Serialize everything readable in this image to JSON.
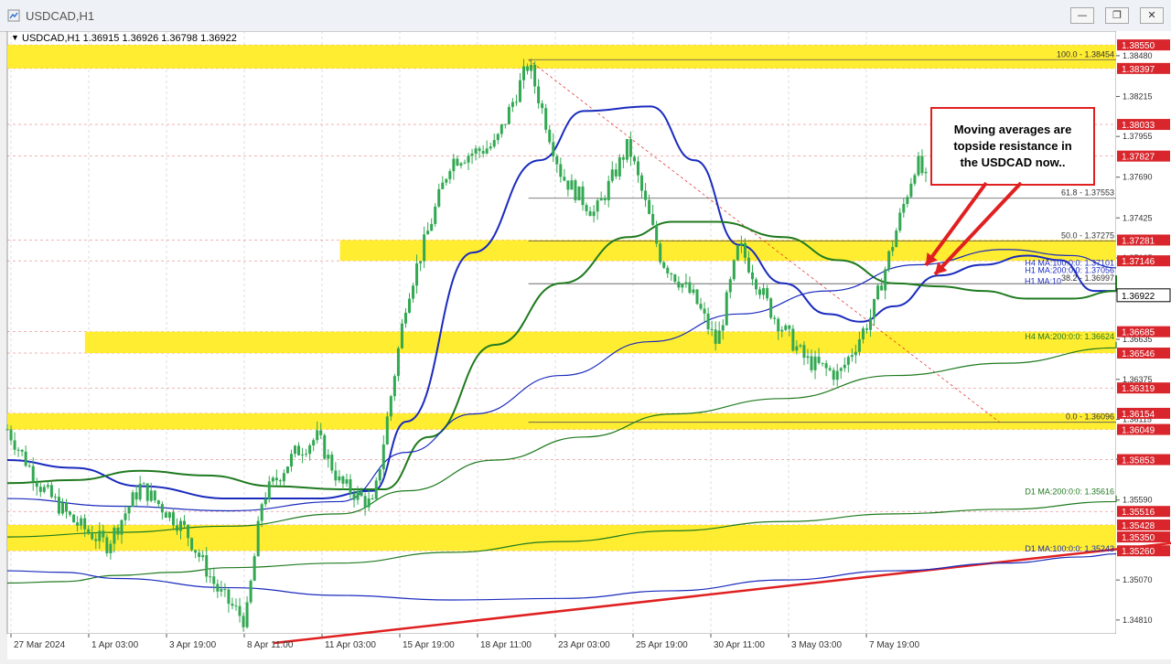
{
  "window": {
    "title": "USDCAD,H1",
    "icons": {
      "app": "chart-window-icon",
      "minimize": "minimize-icon",
      "maximize": "maximize-icon",
      "close": "close-icon"
    }
  },
  "colors": {
    "zone": "#ffec1f",
    "candle": "#32a852",
    "ma_blue": "#1a2bbd",
    "ma_green": "#1f7a1f",
    "trend": "#e02020",
    "callout_border": "#e02020",
    "price_box": "#d9262c"
  },
  "chart_data": {
    "type": "candlestick",
    "symbol_header": "USDCAD,H1  1.36915 1.36926 1.36798 1.36922",
    "ylim": [
      1.3472,
      1.3864
    ],
    "y_ticks": [
      "1.38480",
      "1.38215",
      "1.37955",
      "1.37690",
      "1.37425",
      "1.37165",
      "1.36635",
      "1.36375",
      "1.36115",
      "1.35855",
      "1.35590",
      "1.35070",
      "1.34810"
    ],
    "x_ticks": [
      "27 Mar 2024",
      "1 Apr 03:00",
      "3 Apr 19:00",
      "8 Apr 11:00",
      "11 Apr 03:00",
      "15 Apr 19:00",
      "18 Apr 11:00",
      "23 Apr 03:00",
      "25 Apr 19:00",
      "30 Apr 11:00",
      "3 May 03:00",
      "7 May 19:00"
    ],
    "zones": [
      {
        "low": 1.38397,
        "high": 1.3855,
        "start": 0.0
      },
      {
        "low": 1.37146,
        "high": 1.37281,
        "start": 0.3
      },
      {
        "low": 1.36546,
        "high": 1.36685,
        "start": 0.07
      },
      {
        "low": 1.36049,
        "high": 1.36154,
        "start": 0.0
      },
      {
        "low": 1.3526,
        "high": 1.35428,
        "start": 0.0
      }
    ],
    "price_labels": [
      "1.38550",
      "1.38397",
      "1.38033",
      "1.37827",
      "1.37281",
      "1.37146",
      "1.36685",
      "1.36546",
      "1.36319",
      "1.36154",
      "1.36049",
      "1.35853",
      "1.35516",
      "1.35428",
      "1.35350",
      "1.35260"
    ],
    "current_price": "1.36922",
    "fib_levels": [
      {
        "label": "100.0 - 1.38454",
        "value": 1.38454
      },
      {
        "label": "61.8 - 1.37553",
        "value": 1.37553
      },
      {
        "label": "50.0 - 1.37275",
        "value": 1.37275
      },
      {
        "label": "38.2 - 1.36997",
        "value": 1.36997
      },
      {
        "label": "0.0 - 1.36096",
        "value": 1.36096
      }
    ],
    "ma_labels": [
      {
        "label": "H4 MA:100:0:0: 1.37101",
        "value": 1.37101
      },
      {
        "label": "H1 MA:200:0:0: 1.37056",
        "value": 1.37056
      },
      {
        "label": "H1 MA:10",
        "value": 1.3703
      },
      {
        "label": "H4 MA:200:0:0: 1.36624",
        "value": 1.36624
      },
      {
        "label": "D1 MA:200:0:0: 1.35616",
        "value": 1.35616
      },
      {
        "label": "D1 MA:100:0:0: 1.35243",
        "value": 1.35243
      }
    ],
    "annotation": [
      "Moving averages are",
      "topside resistance in",
      "the USDCAD now.."
    ],
    "keypoints": [
      [
        0.0,
        1.3605
      ],
      [
        0.03,
        1.3568
      ],
      [
        0.06,
        1.3545
      ],
      [
        0.09,
        1.353
      ],
      [
        0.12,
        1.3568
      ],
      [
        0.16,
        1.354
      ],
      [
        0.19,
        1.35
      ],
      [
        0.215,
        1.348
      ],
      [
        0.23,
        1.356
      ],
      [
        0.26,
        1.359
      ],
      [
        0.28,
        1.36
      ],
      [
        0.3,
        1.357
      ],
      [
        0.33,
        1.3555
      ],
      [
        0.36,
        1.369
      ],
      [
        0.4,
        1.378
      ],
      [
        0.44,
        1.379
      ],
      [
        0.47,
        1.3843
      ],
      [
        0.5,
        1.377
      ],
      [
        0.53,
        1.3745
      ],
      [
        0.56,
        1.379
      ],
      [
        0.59,
        1.3715
      ],
      [
        0.62,
        1.369
      ],
      [
        0.64,
        1.366
      ],
      [
        0.66,
        1.3725
      ],
      [
        0.69,
        1.368
      ],
      [
        0.72,
        1.365
      ],
      [
        0.75,
        1.364
      ],
      [
        0.78,
        1.368
      ],
      [
        0.8,
        1.373
      ],
      [
        0.82,
        1.378
      ],
      [
        0.845,
        1.374
      ],
      [
        0.865,
        1.37
      ],
      [
        0.88,
        1.366
      ],
      [
        0.895,
        1.362
      ],
      [
        0.905,
        1.367
      ],
      [
        0.93,
        1.369
      ],
      [
        0.95,
        1.366
      ],
      [
        0.965,
        1.37
      ],
      [
        0.975,
        1.374
      ],
      [
        0.985,
        1.375
      ],
      [
        1.0,
        1.372
      ],
      [
        1.015,
        1.373
      ],
      [
        1.03,
        1.3715
      ],
      [
        1.05,
        1.3692
      ]
    ],
    "ma_series": [
      {
        "name": "H1 MA:100",
        "color": "#1a2bbd",
        "width": 2,
        "points": [
          [
            0.0,
            1.3585
          ],
          [
            0.06,
            1.358
          ],
          [
            0.12,
            1.3568
          ],
          [
            0.2,
            1.356
          ],
          [
            0.28,
            1.356
          ],
          [
            0.33,
            1.3565
          ],
          [
            0.36,
            1.361
          ],
          [
            0.42,
            1.372
          ],
          [
            0.48,
            1.378
          ],
          [
            0.52,
            1.3812
          ],
          [
            0.58,
            1.3815
          ],
          [
            0.62,
            1.378
          ],
          [
            0.66,
            1.3725
          ],
          [
            0.7,
            1.37
          ],
          [
            0.74,
            1.368
          ],
          [
            0.77,
            1.3675
          ],
          [
            0.8,
            1.3685
          ],
          [
            0.84,
            1.3705
          ],
          [
            0.88,
            1.3712
          ],
          [
            0.92,
            1.3718
          ],
          [
            0.95,
            1.3715
          ],
          [
            0.98,
            1.3695
          ],
          [
            1.01,
            1.3695
          ],
          [
            1.04,
            1.3705
          ]
        ]
      },
      {
        "name": "H1 MA:200",
        "color": "#1f7a1f",
        "width": 2,
        "points": [
          [
            0.0,
            1.357
          ],
          [
            0.06,
            1.3572
          ],
          [
            0.12,
            1.3578
          ],
          [
            0.18,
            1.3575
          ],
          [
            0.24,
            1.3568
          ],
          [
            0.3,
            1.3566
          ],
          [
            0.34,
            1.3566
          ],
          [
            0.38,
            1.36
          ],
          [
            0.44,
            1.366
          ],
          [
            0.5,
            1.37
          ],
          [
            0.56,
            1.373
          ],
          [
            0.6,
            1.374
          ],
          [
            0.64,
            1.374
          ],
          [
            0.7,
            1.373
          ],
          [
            0.75,
            1.3715
          ],
          [
            0.8,
            1.37
          ],
          [
            0.84,
            1.3698
          ],
          [
            0.88,
            1.3695
          ],
          [
            0.92,
            1.369
          ],
          [
            0.96,
            1.369
          ],
          [
            1.0,
            1.3695
          ],
          [
            1.04,
            1.3705
          ]
        ]
      },
      {
        "name": "H4 MA:100",
        "color": "#1a2bbd",
        "width": 1.2,
        "points": [
          [
            0.0,
            1.356
          ],
          [
            0.1,
            1.3555
          ],
          [
            0.2,
            1.3552
          ],
          [
            0.3,
            1.3558
          ],
          [
            0.36,
            1.359
          ],
          [
            0.42,
            1.3615
          ],
          [
            0.5,
            1.364
          ],
          [
            0.58,
            1.3662
          ],
          [
            0.66,
            1.368
          ],
          [
            0.74,
            1.3695
          ],
          [
            0.82,
            1.3712
          ],
          [
            0.9,
            1.3722
          ],
          [
            0.96,
            1.3718
          ],
          [
            1.04,
            1.371
          ],
          [
            1.1,
            1.371
          ]
        ]
      },
      {
        "name": "H4 MA:200",
        "color": "#1f7a1f",
        "width": 1.2,
        "points": [
          [
            0.0,
            1.3535
          ],
          [
            0.1,
            1.3538
          ],
          [
            0.2,
            1.3542
          ],
          [
            0.3,
            1.355
          ],
          [
            0.36,
            1.3565
          ],
          [
            0.44,
            1.3585
          ],
          [
            0.52,
            1.36
          ],
          [
            0.6,
            1.3615
          ],
          [
            0.7,
            1.3625
          ],
          [
            0.8,
            1.364
          ],
          [
            0.9,
            1.3648
          ],
          [
            1.0,
            1.3658
          ],
          [
            1.04,
            1.3662
          ],
          [
            1.1,
            1.3662
          ]
        ]
      },
      {
        "name": "D1 MA:200",
        "color": "#1f7a1f",
        "width": 1.2,
        "points": [
          [
            0.0,
            1.3505
          ],
          [
            0.05,
            1.3506
          ],
          [
            0.1,
            1.351
          ],
          [
            0.15,
            1.3512
          ],
          [
            0.2,
            1.3515
          ],
          [
            0.3,
            1.3518
          ],
          [
            0.4,
            1.3525
          ],
          [
            0.5,
            1.3532
          ],
          [
            0.6,
            1.3539
          ],
          [
            0.7,
            1.3545
          ],
          [
            0.8,
            1.355
          ],
          [
            0.9,
            1.3553
          ],
          [
            1.0,
            1.3558
          ],
          [
            1.06,
            1.3562
          ],
          [
            1.1,
            1.3562
          ]
        ]
      },
      {
        "name": "D1 MA:100",
        "color": "#1a2bbd",
        "width": 1.2,
        "points": [
          [
            0.0,
            1.3513
          ],
          [
            0.05,
            1.3512
          ],
          [
            0.1,
            1.3508
          ],
          [
            0.2,
            1.3502
          ],
          [
            0.3,
            1.3497
          ],
          [
            0.4,
            1.3494
          ],
          [
            0.5,
            1.3495
          ],
          [
            0.6,
            1.35
          ],
          [
            0.7,
            1.3507
          ],
          [
            0.8,
            1.3513
          ],
          [
            0.9,
            1.3518
          ],
          [
            0.97,
            1.3522
          ],
          [
            1.0,
            1.3524
          ],
          [
            1.1,
            1.3524
          ]
        ]
      }
    ],
    "trendline": {
      "x": [
        0.24,
        1.1
      ],
      "y": [
        1.3466,
        1.3535
      ]
    }
  }
}
